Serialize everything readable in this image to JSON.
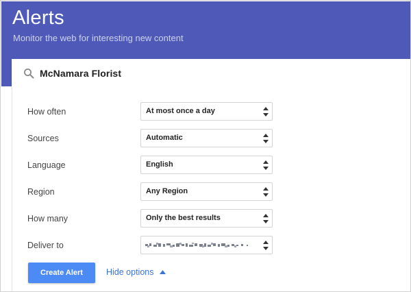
{
  "header": {
    "title": "Alerts",
    "subtitle": "Monitor the web for interesting new content",
    "color": "#4f5ab8"
  },
  "search": {
    "icon": "search-icon",
    "value": "McNamara Florist"
  },
  "options": [
    {
      "label": "How often",
      "value": "At most once a day"
    },
    {
      "label": "Sources",
      "value": "Automatic"
    },
    {
      "label": "Language",
      "value": "English"
    },
    {
      "label": "Region",
      "value": "Any Region"
    },
    {
      "label": "How many",
      "value": "Only the best results"
    },
    {
      "label": "Deliver to",
      "value": ""
    }
  ],
  "actions": {
    "create_label": "Create Alert",
    "create_color": "#4c8bf5",
    "hide_options_label": "Hide options",
    "link_color": "#3b73d8"
  }
}
